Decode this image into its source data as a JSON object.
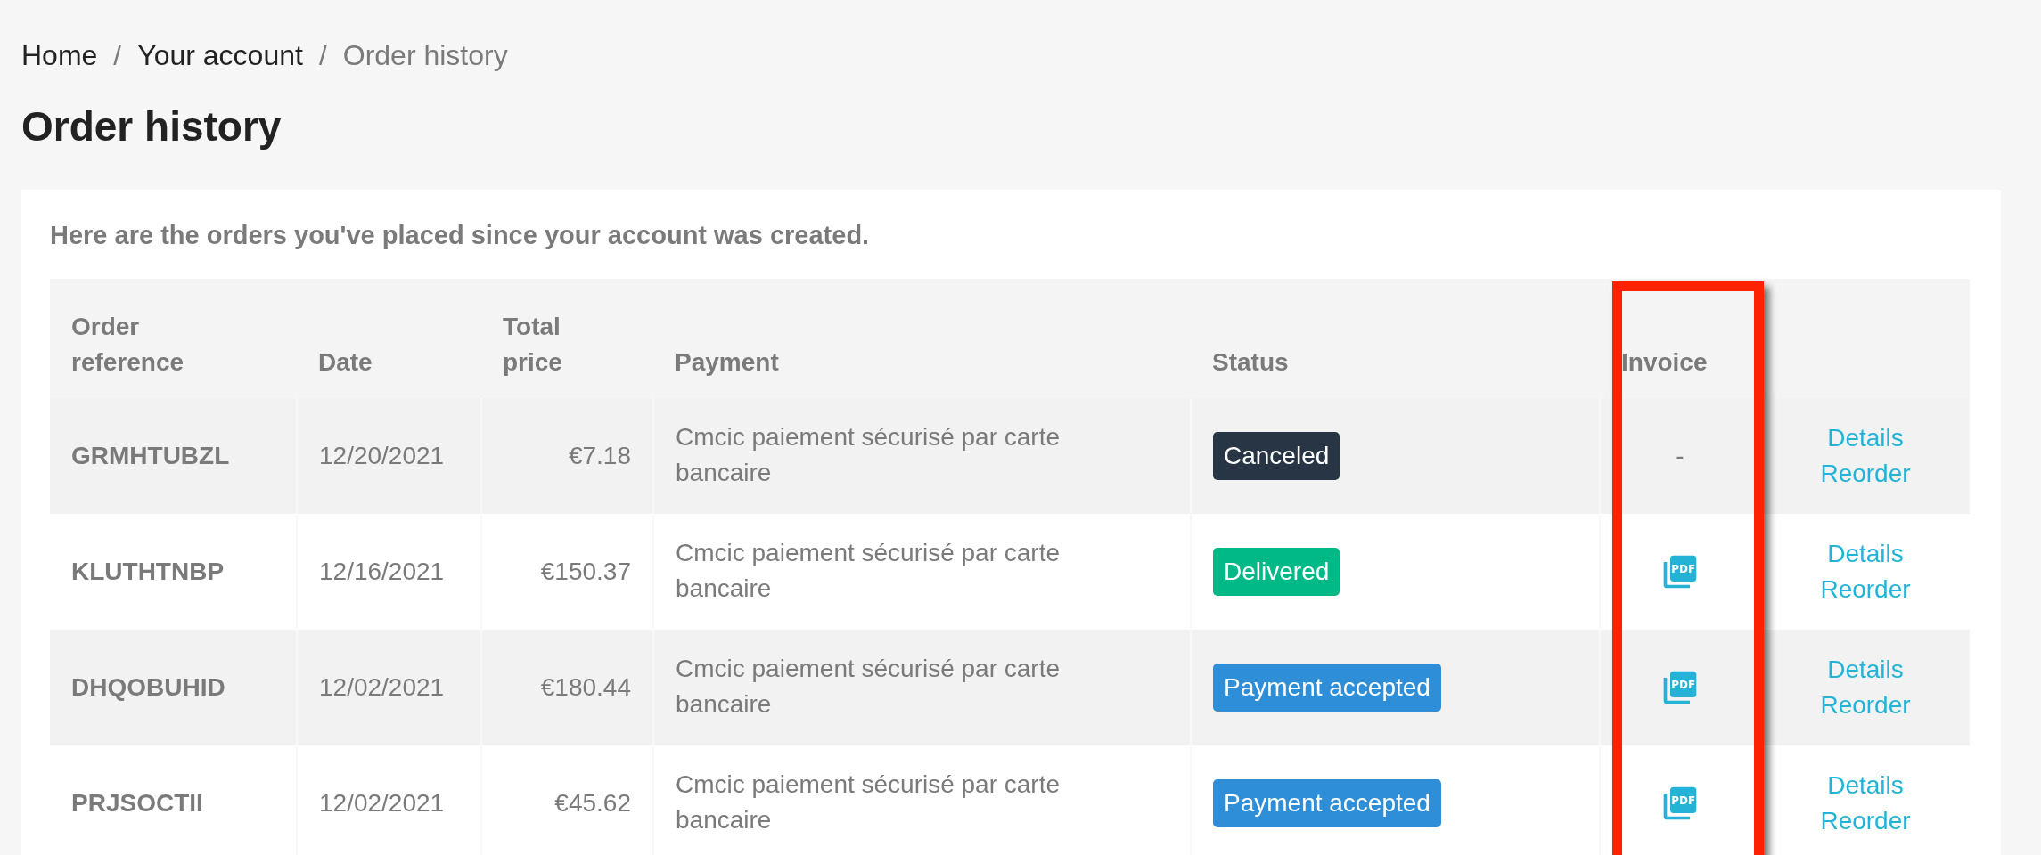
{
  "breadcrumb": [
    {
      "label": "Home",
      "current": false
    },
    {
      "label": "Your account",
      "current": false
    },
    {
      "label": "Order history",
      "current": true
    }
  ],
  "separator": "/",
  "title": "Order history",
  "intro": "Here are the orders you've placed since your account was created.",
  "table": {
    "columns": [
      {
        "label": "Order reference",
        "highlighted": false
      },
      {
        "label": "Date",
        "highlighted": false
      },
      {
        "label": "Total price",
        "highlighted": false
      },
      {
        "label": "Payment",
        "highlighted": false
      },
      {
        "label": "Status",
        "highlighted": false
      },
      {
        "label": "Invoice",
        "highlighted": true
      }
    ],
    "rows": [
      {
        "reference": "GRMHTUBZL",
        "date": "12/20/2021",
        "total": "€7.18",
        "payment": "Cmcic paiement sécurisé par carte bancaire",
        "status": {
          "label": "Canceled",
          "color": "#283545"
        },
        "invoice": {
          "kind": "text",
          "text": "-"
        },
        "actions": [
          "Details",
          "Reorder"
        ]
      },
      {
        "reference": "KLUTHTNBP",
        "date": "12/16/2021",
        "total": "€150.37",
        "payment": "Cmcic paiement sécurisé par carte bancaire",
        "status": {
          "label": "Delivered",
          "color": "#01b887"
        },
        "invoice": {
          "kind": "pdf",
          "label": "PDF"
        },
        "actions": [
          "Details",
          "Reorder"
        ]
      },
      {
        "reference": "DHQOBUHID",
        "date": "12/02/2021",
        "total": "€180.44",
        "payment": "Cmcic paiement sécurisé par carte bancaire",
        "status": {
          "label": "Payment accepted",
          "color": "#2e8fd8"
        },
        "invoice": {
          "kind": "pdf",
          "label": "PDF"
        },
        "actions": [
          "Details",
          "Reorder"
        ]
      },
      {
        "reference": "PRJSOCTII",
        "date": "12/02/2021",
        "total": "€45.62",
        "payment": "Cmcic paiement sécurisé par carte bancaire",
        "status": {
          "label": "Payment accepted",
          "color": "#2e8fd8"
        },
        "invoice": {
          "kind": "pdf",
          "label": "PDF"
        },
        "actions": [
          "Details",
          "Reorder"
        ]
      }
    ]
  }
}
